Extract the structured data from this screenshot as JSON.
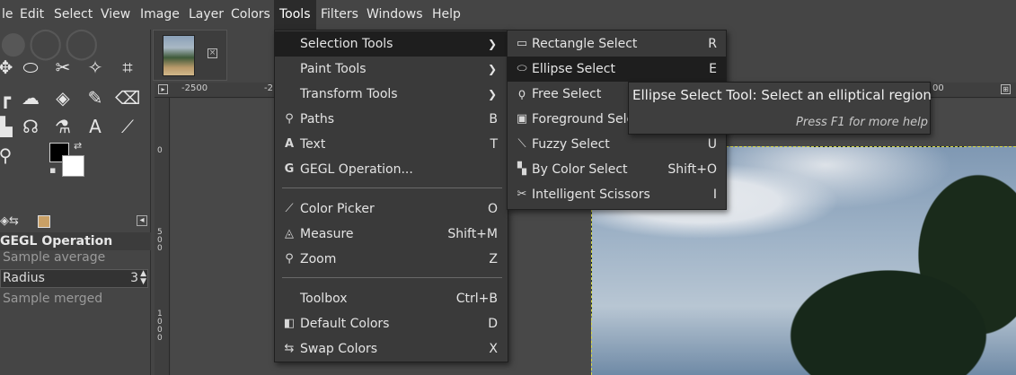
{
  "menubar": {
    "items": [
      "le",
      "Edit",
      "Select",
      "View",
      "Image",
      "Layer",
      "Colors",
      "Tools",
      "Filters",
      "Windows",
      "Help"
    ],
    "active": "Tools"
  },
  "tools_menu": {
    "items": [
      {
        "label": "Selection Tools",
        "icon": "none",
        "accel": "",
        "submenu": true,
        "highlight": true
      },
      {
        "label": "Paint Tools",
        "icon": "none",
        "accel": "",
        "submenu": true
      },
      {
        "label": "Transform Tools",
        "icon": "none",
        "accel": "",
        "submenu": true
      },
      {
        "label": "Paths",
        "icon": "paths-icon",
        "accel": "B"
      },
      {
        "label": "Text",
        "icon": "text-icon",
        "accel": "T"
      },
      {
        "label": "GEGL Operation...",
        "icon": "gegl-icon",
        "accel": ""
      },
      {
        "label": "Color Picker",
        "icon": "color-picker-icon",
        "accel": "O"
      },
      {
        "label": "Measure",
        "icon": "measure-icon",
        "accel": "Shift+M"
      },
      {
        "label": "Zoom",
        "icon": "zoom-icon",
        "accel": "Z"
      },
      {
        "label": "Toolbox",
        "icon": "none",
        "accel": "Ctrl+B"
      },
      {
        "label": "Default Colors",
        "icon": "default-colors-icon",
        "accel": "D"
      },
      {
        "label": "Swap Colors",
        "icon": "swap-colors-icon",
        "accel": "X"
      }
    ]
  },
  "selection_submenu": {
    "items": [
      {
        "label": "Rectangle Select",
        "icon": "rectangle-select-icon",
        "accel": "R"
      },
      {
        "label": "Ellipse Select",
        "icon": "ellipse-select-icon",
        "accel": "E",
        "highlight": true
      },
      {
        "label": "Free Select",
        "icon": "free-select-icon",
        "accel": ""
      },
      {
        "label": "Foreground Sele",
        "icon": "foreground-select-icon",
        "accel": ""
      },
      {
        "label": "Fuzzy Select",
        "icon": "fuzzy-select-icon",
        "accel": "U"
      },
      {
        "label": "By Color Select",
        "icon": "by-color-select-icon",
        "accel": "Shift+O"
      },
      {
        "label": "Intelligent Scissors",
        "icon": "scissors-icon",
        "accel": "I"
      }
    ]
  },
  "tooltip": {
    "text": "Ellipse Select Tool: Select an elliptical region",
    "help": "Press F1 for more help"
  },
  "tool_options": {
    "title": "GEGL Operation",
    "sample_average": "Sample average",
    "radius_label": "Radius",
    "radius_value": "3",
    "sample_merged": "Sample merged"
  },
  "rulers": {
    "top": [
      "-2500",
      "-2",
      "00"
    ],
    "left": [
      "0",
      "500",
      "1000"
    ]
  },
  "colors": {
    "menubar_bg": "#454545",
    "menu_bg": "#3a3a3a",
    "menu_highlight": "#1e1e1e",
    "selection_marching_ants": "#d8d84a"
  }
}
